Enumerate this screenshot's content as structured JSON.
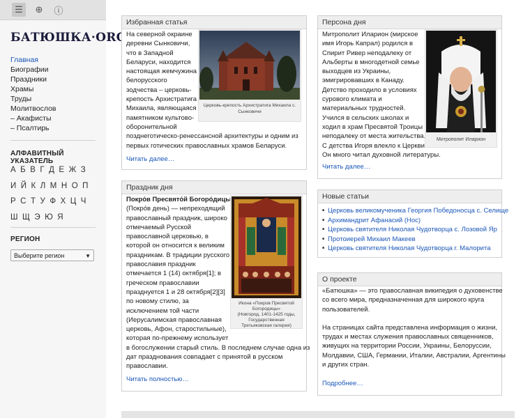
{
  "toolbar": {
    "menu_icon": "☰",
    "zoom_icon": "⊕",
    "info_icon": "ⓘ"
  },
  "logo": "БАТЮШКА·ORG",
  "nav": [
    {
      "label": "Главная",
      "active": true
    },
    {
      "label": "Биографии"
    },
    {
      "label": "Праздники"
    },
    {
      "label": "Храмы"
    },
    {
      "label": "Труды"
    },
    {
      "label": "Молитвослов"
    },
    {
      "label": "– Акафисты"
    },
    {
      "label": "– Псалтирь"
    }
  ],
  "alphabet": {
    "title": "АЛФАВИТНЫЙ УКАЗАТЕЛЬ",
    "rows": [
      [
        "А",
        "Б",
        "В",
        "Г",
        "Д",
        "Е",
        "Ж",
        "З"
      ],
      [
        "И",
        "Й",
        "К",
        "Л",
        "М",
        "Н",
        "О",
        "П"
      ],
      [
        "Р",
        "С",
        "Т",
        "У",
        "Ф",
        "Х",
        "Ц",
        "Ч"
      ],
      [
        "Ш",
        "Щ",
        "Э",
        "Ю",
        "Я"
      ]
    ]
  },
  "region": {
    "title": "РЕГИОН",
    "select_value": "Выберите регион"
  },
  "featured": {
    "header": "Избранная статья",
    "text_lines": [
      "На северной окраине",
      "деревни Сынковичи,",
      "что в Западной",
      "Беларуси, находится",
      "настоящая жемчужина",
      "белорусского",
      "зодчества – церковь-",
      "крепость Архистратига",
      "Михаила, являющаяся",
      "памятником культово-",
      "оборонительной",
      "позднеготическо-ренессансной архитектуры и одним из",
      "первых готических православных храмов Беларуси."
    ],
    "caption_lines": [
      "Церковь-крепость Архистратига Михаила с.",
      "Сынковичи"
    ],
    "more": "Читать далее…"
  },
  "persona": {
    "header": "Персона дня",
    "text_lines": [
      "Митрополит Иларион (мирское",
      "имя Игорь Капрал) родился в",
      "Спирит Ривер неподалеку от",
      "Альберты в многодетной семье",
      "выходцев из Украины,",
      "эмигрировавших в Канаду.",
      "Детство проходило в условиях",
      "сурового климата и",
      "материальных трудностей.",
      "Учился в сельских школах и",
      "ходил в храм Пресвятой Троицы",
      "неподалеку от места жительства.",
      "С детства Игоря влекло к Церкви.",
      "Он много читал духовной литературы."
    ],
    "caption": "Митрополит Иларион",
    "more": "Читать далее…"
  },
  "holiday": {
    "header": "Праздник дня",
    "title": "Покро́в Пресвято́й Богоро́дицы",
    "text_lines": [
      "(Покро́в день) — непреходящий",
      "православный праздник, широко",
      "отмечаемый Русской",
      "православной церковью, в",
      "которой он относится к великим",
      "праздникам. В традиции русского",
      "православия праздник",
      "отмечается 1 (14) октября[1]; в",
      "греческом православии",
      "празднуется 1 и 28 октября[2][3]",
      "по новому стилю, за",
      "исключением той части",
      "(Иерусалимская православная",
      "церковь, Афон, старостильные),",
      "которая по-прежнему использует",
      "в богослужении старый стиль. В последнем случае одна из",
      "дат празднования совпадает с принятой в русском",
      "православии."
    ],
    "caption_lines": [
      "Икона «Покров Пресвятой",
      "Богородицы»",
      "(Новгород, 1401-1425 годы,",
      "Государственная",
      "Третьяковская галерея)"
    ],
    "more": "Читать полностью…"
  },
  "new_articles": {
    "header": "Новые статьи",
    "items": [
      "Церковь великомученика Георгия Победоносца с. Селище",
      "Архимандрит Афанасий (Нос)",
      "Церковь святителя Николая Чудотворца с. Лозовой Яр",
      "Протоиерей Михаил Макеев",
      "Церковь святителя Николая Чудотворца г. Малорита"
    ]
  },
  "about": {
    "header": "О проекте",
    "p1_lines": [
      "«Батюшка» — это православная википедия о духовенстве",
      "со всего мира, предназначенная для широкого круга",
      "пользователей."
    ],
    "p2_lines": [
      "На страницах сайта представлена информация о жизни,",
      "трудах и местах служения православных священников,",
      "живущих на территории России, Украины, Белоруссии,",
      "Молдавии, США, Германии, Италии, Австралии, Аргентины",
      "и других стран."
    ],
    "more": "Подробнее…"
  },
  "colors": {
    "link": "#1a56b8",
    "sidebar_bg": "#f6f6f6",
    "box_header_bg": "#eeeeee"
  }
}
